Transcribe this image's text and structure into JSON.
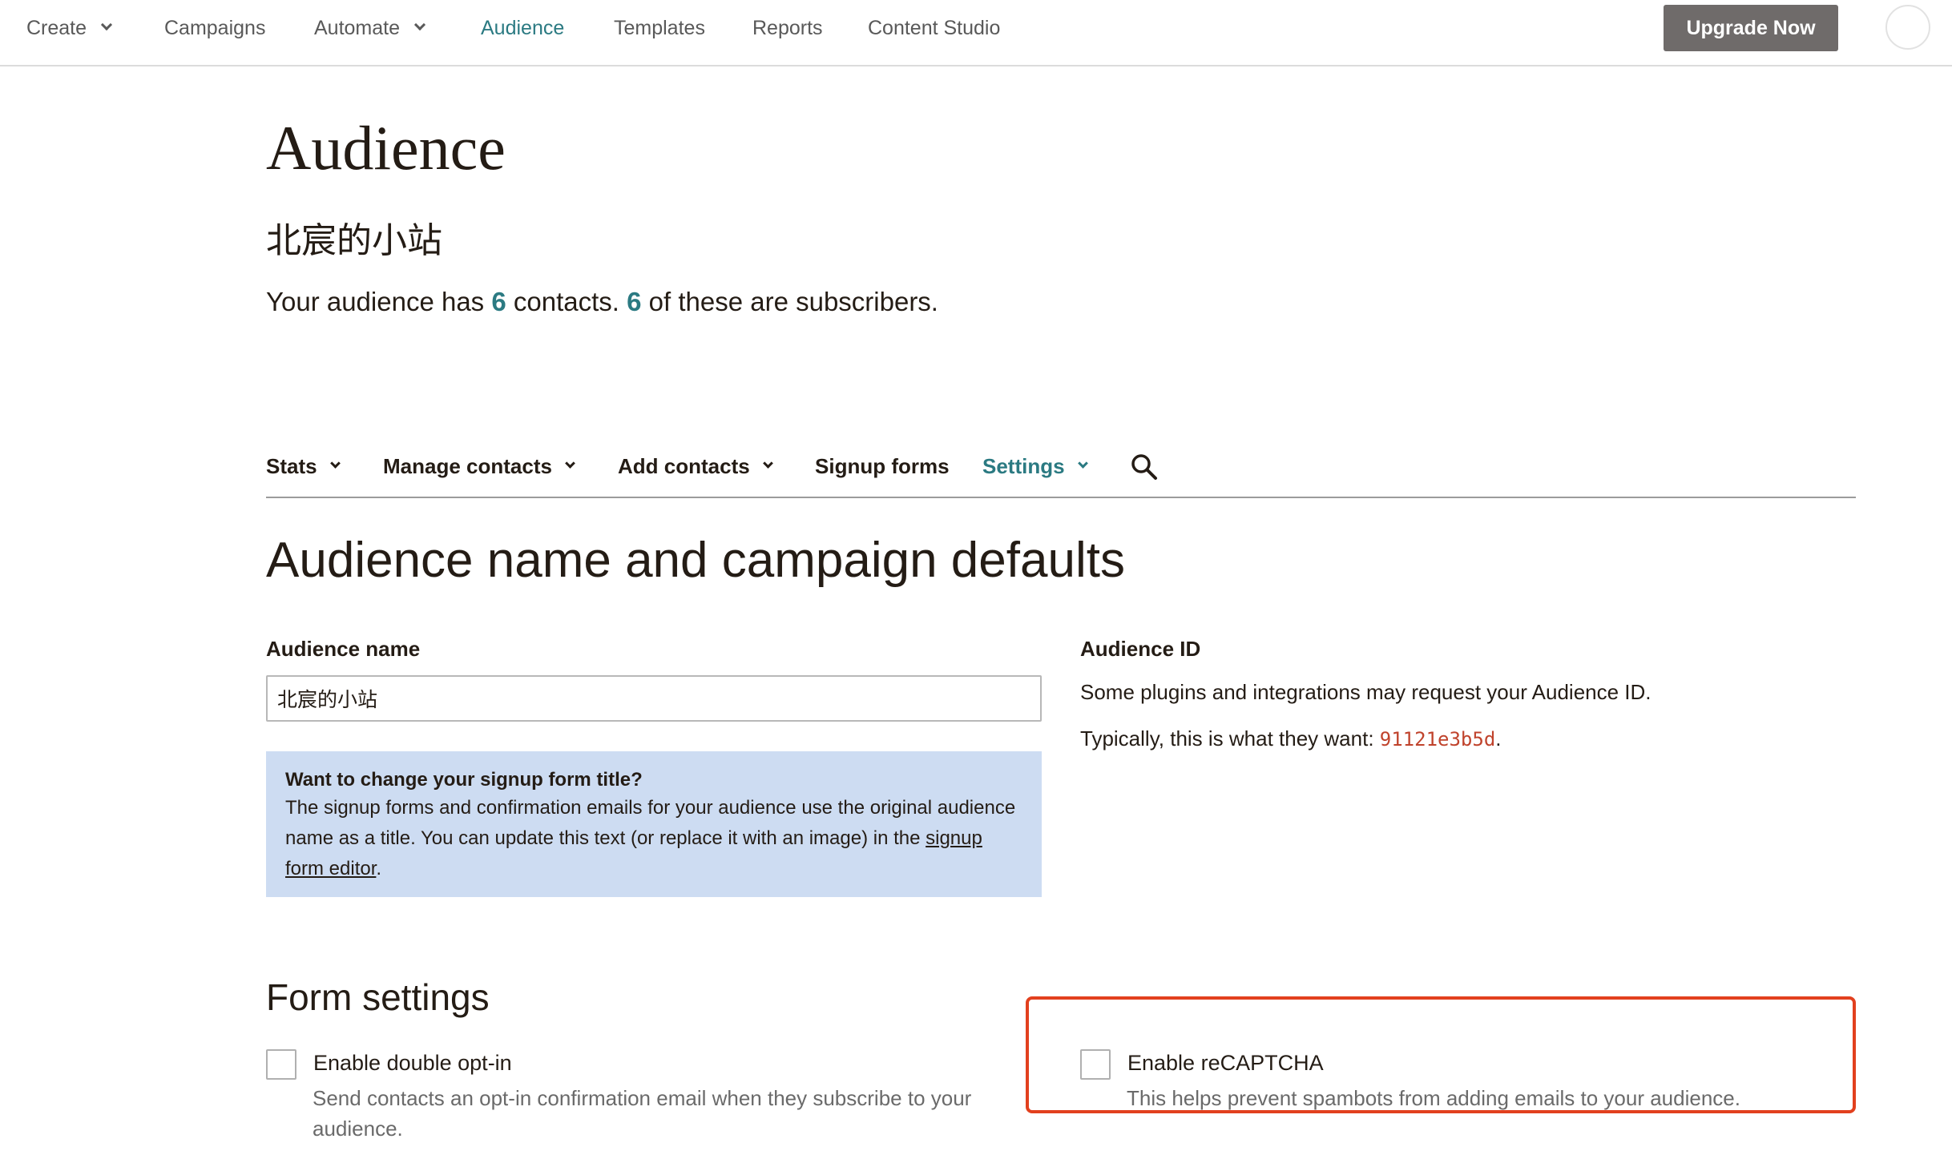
{
  "topnav": {
    "items": [
      {
        "label": "Create",
        "dropdown": true
      },
      {
        "label": "Campaigns",
        "dropdown": false
      },
      {
        "label": "Automate",
        "dropdown": true
      },
      {
        "label": "Audience",
        "dropdown": false,
        "active": true
      },
      {
        "label": "Templates",
        "dropdown": false
      },
      {
        "label": "Reports",
        "dropdown": false
      },
      {
        "label": "Content Studio",
        "dropdown": false
      }
    ],
    "upgrade_label": "Upgrade Now"
  },
  "header": {
    "title": "Audience",
    "audience_name": "北宸的小站",
    "summary_prefix": "Your audience has ",
    "contacts_count": "6",
    "summary_middle": " contacts. ",
    "subscribers_count": "6",
    "summary_suffix": " of these are subscribers."
  },
  "subnav": {
    "items": [
      {
        "label": "Stats",
        "dropdown": true
      },
      {
        "label": "Manage contacts",
        "dropdown": true
      },
      {
        "label": "Add contacts",
        "dropdown": true
      },
      {
        "label": "Signup forms",
        "dropdown": false
      },
      {
        "label": "Settings",
        "dropdown": true,
        "active": true
      }
    ],
    "search_icon": "search-icon"
  },
  "section": {
    "title": "Audience name and campaign defaults"
  },
  "audience_name_field": {
    "label": "Audience name",
    "value": "北宸的小站"
  },
  "info_box": {
    "title": "Want to change your signup form title?",
    "body": "The signup forms and confirmation emails for your audience use the original audience name as a title. You can update this text (or replace it with an image) in the ",
    "link": "signup form editor",
    "end": "."
  },
  "audience_id": {
    "label": "Audience ID",
    "line1": "Some plugins and integrations may request your Audience ID.",
    "line2_prefix": "Typically, this is what they want: ",
    "id_value": "91121e3b5d",
    "line2_suffix": "."
  },
  "form_settings": {
    "title": "Form settings",
    "double_optin": {
      "label": "Enable double opt-in",
      "desc": "Send contacts an opt-in confirmation email when they subscribe to your audience.",
      "checked": false
    },
    "recaptcha": {
      "label": "Enable reCAPTCHA",
      "desc": "This helps prevent spambots from adding emails to your audience.",
      "checked": false
    }
  },
  "colors": {
    "accent": "#2b7a82",
    "upgrade_button": "#6f6b6a",
    "info_box": "#cddcf2",
    "highlight": "#e2401e",
    "id_code": "#c0432c"
  }
}
